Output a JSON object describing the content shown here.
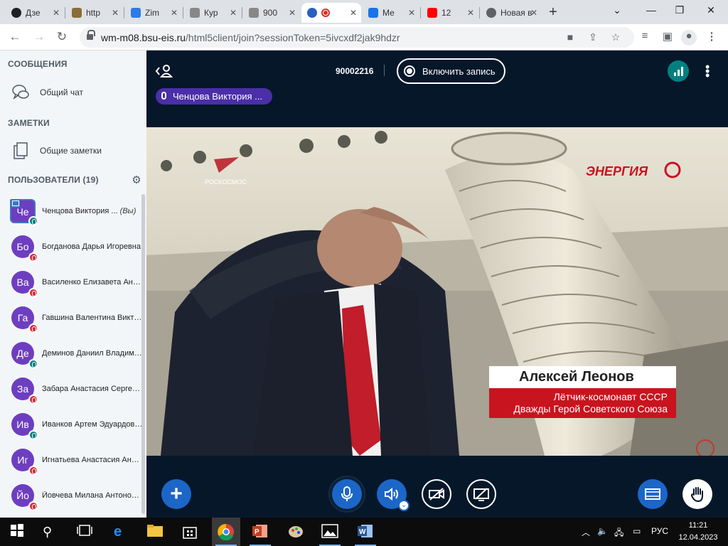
{
  "browser": {
    "tabs": [
      {
        "label": "Дзе",
        "icon": "plus-circle-icon",
        "color": "#202124"
      },
      {
        "label": "http",
        "icon": "image-icon",
        "color": "#8a6d3b"
      },
      {
        "label": "Zim",
        "icon": "zimbra-icon",
        "color": "#2d7be5"
      },
      {
        "label": "Кур",
        "icon": "image-icon",
        "color": "#777"
      },
      {
        "label": "900",
        "icon": "image-icon",
        "color": "#777"
      },
      {
        "label": "",
        "icon": "bbb-icon",
        "color": "#2b5fbf",
        "active": true
      },
      {
        "label": "Ме",
        "icon": "chat-icon",
        "color": "#1a73e8"
      },
      {
        "label": "12",
        "icon": "youtube-icon",
        "color": "#ff0000"
      },
      {
        "label": "Новая в",
        "icon": "chrome-icon",
        "color": "#5f6368"
      }
    ],
    "url_host": "wm-m08.bsu-eis.ru",
    "url_path": "/html5client/join?sessionToken=5ivcxdf2jak9hdzr"
  },
  "sidebar": {
    "messages_title": "СООБЩЕНИЯ",
    "public_chat": "Общий чат",
    "notes_title": "ЗАМЕТКИ",
    "shared_notes": "Общие заметки",
    "users_title": "ПОЛЬЗОВАТЕЛИ (19)",
    "you_suffix": "(Вы)",
    "users": [
      {
        "initials": "Че",
        "name": "Ченцова Виктория ...",
        "status": "green",
        "me": true
      },
      {
        "initials": "Бо",
        "name": "Богданова Дарья Игоревна",
        "status": "red"
      },
      {
        "initials": "Ва",
        "name": "Василенко Елизавета Андреевна",
        "status": "red"
      },
      {
        "initials": "Га",
        "name": "Гавшина Валентина Викторовна",
        "status": "red"
      },
      {
        "initials": "Де",
        "name": "Деминов Даниил Владимирович",
        "status": "green"
      },
      {
        "initials": "За",
        "name": "Забара Анастасия Сергеевна",
        "status": "red"
      },
      {
        "initials": "Ив",
        "name": "Иванков Артем Эдуардович",
        "status": "green"
      },
      {
        "initials": "Иг",
        "name": "Игнатьева Анастасия Андреевна",
        "status": "red"
      },
      {
        "initials": "Йо",
        "name": "Йовчева Милана Антоновна",
        "status": "red"
      }
    ]
  },
  "meeting": {
    "id": "90002216",
    "record_label": "Включить запись",
    "talker": "Ченцова Виктория ...",
    "video": {
      "logo_left": "РОСКОСМОС",
      "logo_right": "ЭНЕРГИЯ",
      "name": "Алексей Леонов",
      "subtitle1": "Лётчик-космонавт СССР",
      "subtitle2": "Дважды Герой Советского Союза"
    }
  },
  "taskbar": {
    "lang": "РУС",
    "time": "11:21",
    "date": "12.04.2023"
  },
  "colors": {
    "accent": "#1c66c8",
    "dark_bg": "#06172a",
    "avatar": "#6d3ec0",
    "talker": "#4a2fa8",
    "muted": "#df2a3a",
    "listen": "#008081"
  }
}
